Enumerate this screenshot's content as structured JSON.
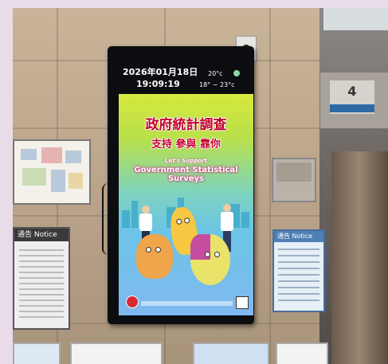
{
  "display": {
    "date": "2026年01月18日",
    "time": "19:09:19",
    "temperature_now": "20°c",
    "temperature_range": "18° ~ 23°c"
  },
  "poster": {
    "title_zh": "政府統計調查",
    "slogan_zh": "支持 參與 靠你",
    "subtitle_en": "Let's Support",
    "title_en": "Government Statistical Surveys"
  },
  "wall": {
    "elevator_floor": "4",
    "notice_left": "通告 Notice",
    "notice_right": "通告 Notice"
  },
  "colors": {
    "title_red": "#c3002f",
    "poster_top": "#d6e83e",
    "poster_bottom": "#7fb9f0"
  }
}
